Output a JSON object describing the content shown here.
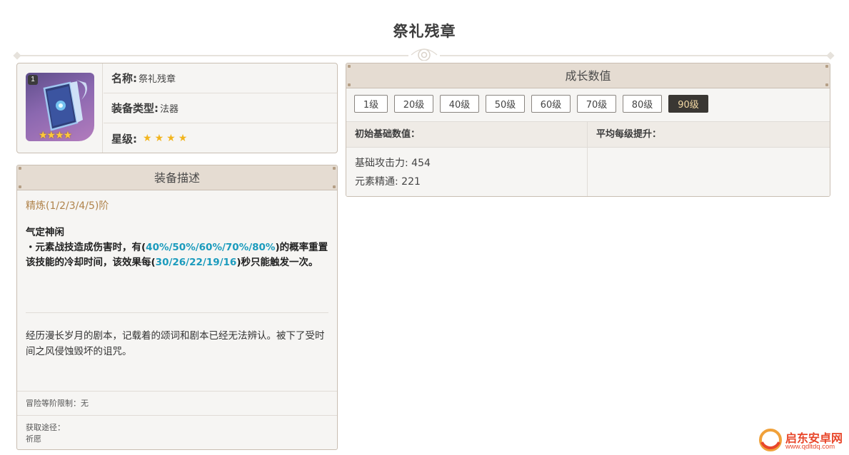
{
  "page": {
    "title": "祭礼残章"
  },
  "info": {
    "refine_badge": "1",
    "icon_stars": "★★★★",
    "rows": [
      {
        "key": "名称:",
        "value": "祭礼残章"
      },
      {
        "key": "装备类型:",
        "value": "法器"
      },
      {
        "key": "星级:",
        "stars": 4
      }
    ]
  },
  "description": {
    "header": "装备描述",
    "refine_label": "精炼(1/2/3/4/5)阶",
    "skill_name": "气定神闲",
    "skill_parts": [
      "・元素战技造成伤害时，有(",
      "40%/50%/60%/70%/80%",
      ")的概率重置该技能的冷却时间，该效果每(",
      "30/26/22/19/16",
      ")秒只能触发一次。"
    ],
    "lore": "经历漫长岁月的剧本，记载着的颂词和剧本已经无法辨认。被下了受时间之风侵蚀毁坏的诅咒。",
    "rank_limit": "冒险等阶限制：无",
    "source_label": "获取途径：",
    "source_value": "祈愿"
  },
  "growth": {
    "header": "成长数值",
    "levels": [
      "1级",
      "20级",
      "40级",
      "50级",
      "60级",
      "70级",
      "80级",
      "90级"
    ],
    "active_level": "90级",
    "col_base": "初始基础数值：",
    "col_avg": "平均每级提升：",
    "stats": [
      "基础攻击力: 454",
      "元素精通: 221"
    ]
  },
  "watermark": {
    "name": "启东安卓网",
    "url": "www.qdltdq.com"
  },
  "colors": {
    "accent": "#1b9bbd",
    "refine": "#b0834b",
    "active_btn": "#3a3733",
    "panel_head": "#e5dcd2"
  }
}
